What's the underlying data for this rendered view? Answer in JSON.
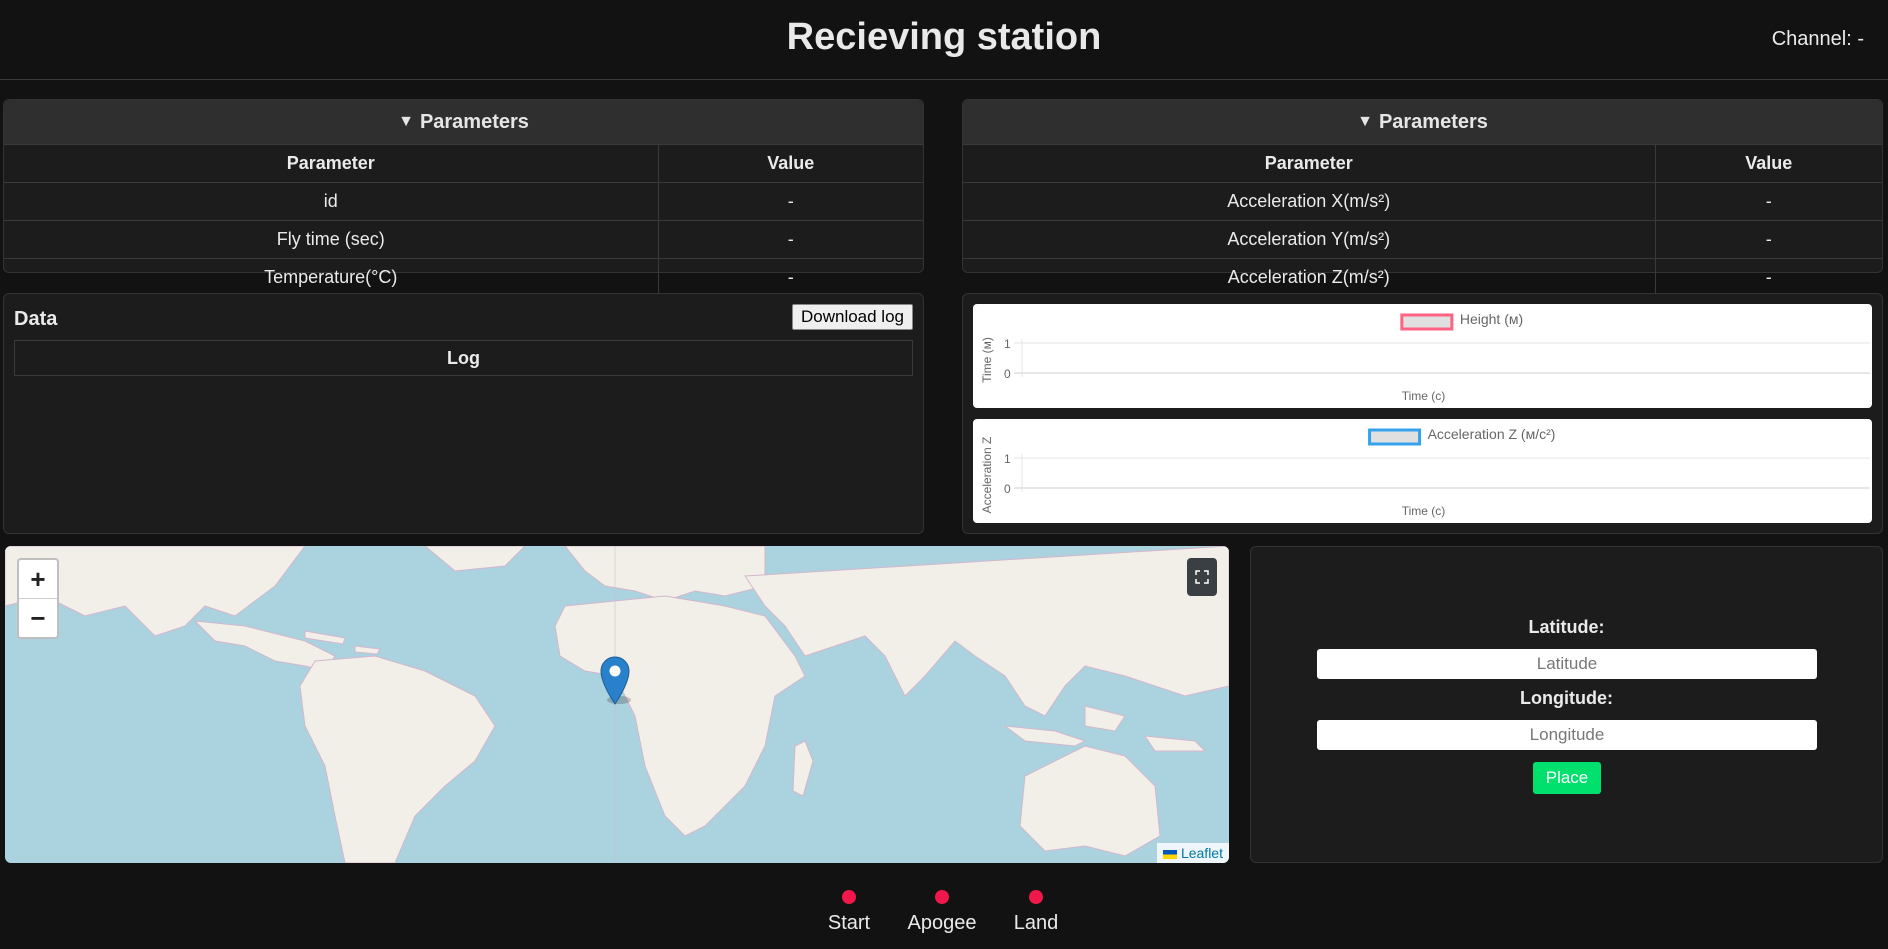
{
  "header": {
    "title": "Recieving station",
    "channel_label": "Channel:",
    "channel_value": "-"
  },
  "left_params": {
    "title": "Parameters",
    "columns": [
      "Parameter",
      "Value"
    ],
    "rows": [
      {
        "name": "id",
        "value": "-"
      },
      {
        "name": "Fly time (sec)",
        "value": "-"
      },
      {
        "name": "Temperature(°C)",
        "value": "-"
      }
    ]
  },
  "right_params": {
    "title": "Parameters",
    "columns": [
      "Parameter",
      "Value"
    ],
    "rows": [
      {
        "name": "Acceleration X(m/s²)",
        "value": "-"
      },
      {
        "name": "Acceleration Y(m/s²)",
        "value": "-"
      },
      {
        "name": "Acceleration Z(m/s²)",
        "value": "-"
      }
    ]
  },
  "data_panel": {
    "title": "Data",
    "download_label": "Download log",
    "log_header": "Log"
  },
  "chart_data": [
    {
      "type": "line",
      "series": [
        {
          "name": "Height (м)",
          "values": []
        }
      ],
      "ylabel": "Time (м)",
      "xlabel": "Time (c)",
      "yticks": [
        "1",
        "0"
      ],
      "ylim": [
        0,
        1
      ],
      "color": "#ff6384"
    },
    {
      "type": "line",
      "series": [
        {
          "name": "Acceleration Z (м/с²)",
          "values": []
        }
      ],
      "ylabel": "Acceleration Z",
      "xlabel": "Time (c)",
      "yticks": [
        "1",
        "0"
      ],
      "ylim": [
        0,
        1
      ],
      "color": "#36a2eb"
    }
  ],
  "map": {
    "zoom_in": "+",
    "zoom_out": "−",
    "attribution": "Leaflet"
  },
  "coords": {
    "lat_label": "Latitude:",
    "lat_placeholder": "Latitude",
    "lon_label": "Longitude:",
    "lon_placeholder": "Longitude",
    "place_label": "Place"
  },
  "status": [
    {
      "label": "Start",
      "color": "#f0184a"
    },
    {
      "label": "Apogee",
      "color": "#f0184a"
    },
    {
      "label": "Land",
      "color": "#f0184a"
    }
  ]
}
